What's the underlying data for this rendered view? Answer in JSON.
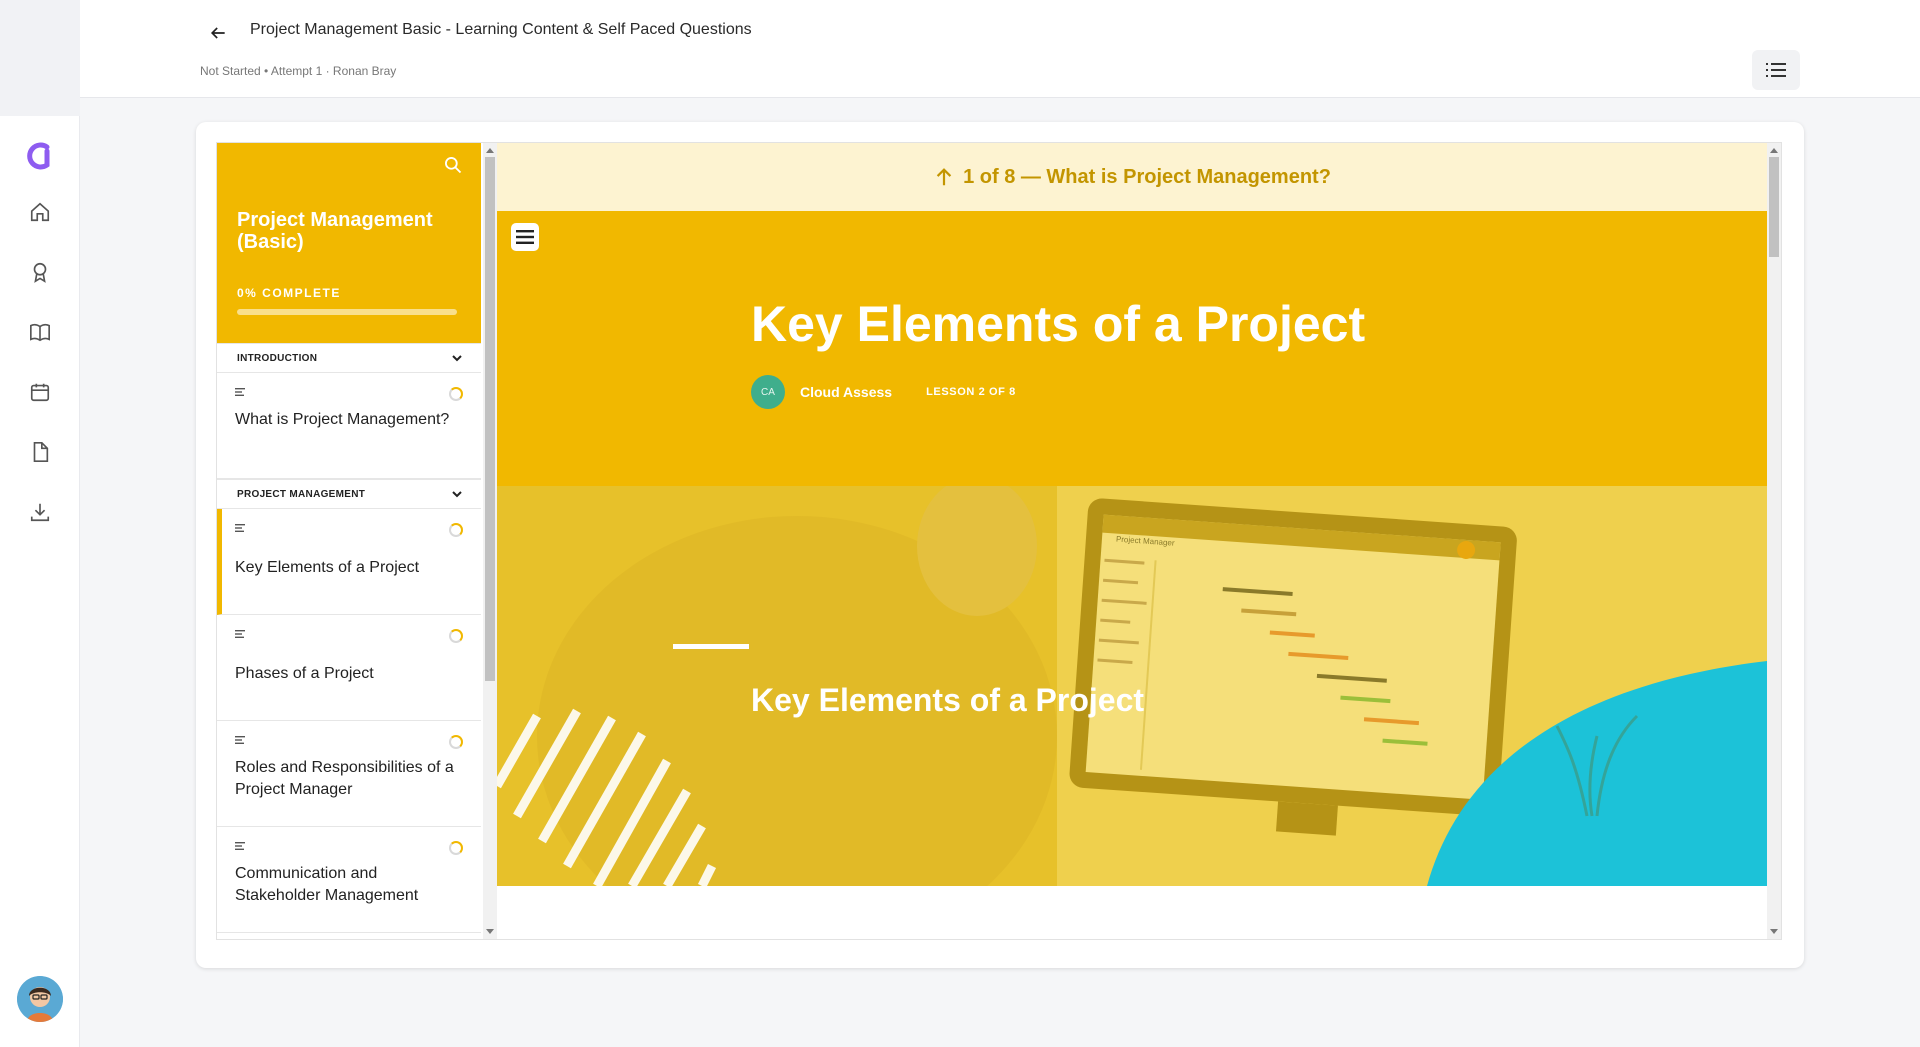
{
  "header": {
    "title": "Project Management Basic - Learning Content & Self Paced Questions",
    "meta": "Not Started • Attempt 1 · Ronan Bray"
  },
  "nav": {
    "items": [
      "home-icon",
      "award-icon",
      "book-icon",
      "calendar-icon",
      "file-icon",
      "download-icon"
    ],
    "accent": "#8e5cf0"
  },
  "sidebar": {
    "course_title": "Project Management (Basic)",
    "progress_label": "0% COMPLETE",
    "progress": 0,
    "accent": "#f1b800",
    "sections": [
      {
        "label": "INTRODUCTION",
        "lessons": [
          {
            "name": "What is Project Management?"
          }
        ]
      },
      {
        "label": "PROJECT MANAGEMENT",
        "lessons": [
          {
            "name": "Key Elements of a Project",
            "active": true
          },
          {
            "name": "Phases of a Project"
          },
          {
            "name": "Roles and Responsibilities of a Project Manager"
          },
          {
            "name": "Communication and Stakeholder Management"
          }
        ]
      }
    ]
  },
  "content": {
    "prev_link": "1 of 8 — What is Project Management?",
    "title": "Key Elements of a Project",
    "author_initials": "CA",
    "author": "Cloud Assess",
    "lesson_counter": "LESSON 2 OF 8",
    "banner_title": "Key Elements of a Project",
    "banner_app_title": "Project Manager"
  }
}
